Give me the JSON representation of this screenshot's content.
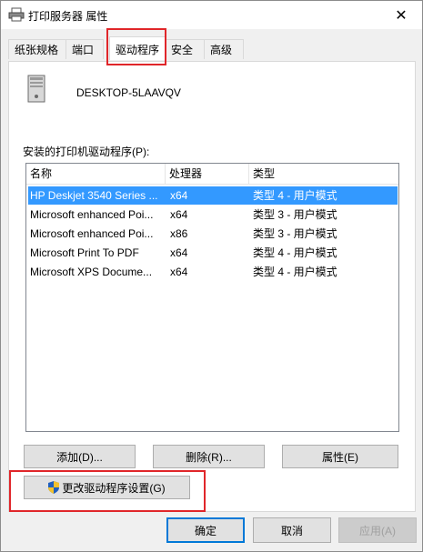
{
  "window": {
    "title": "打印服务器 属性",
    "close_glyph": "✕"
  },
  "tabs": [
    {
      "label": "纸张规格"
    },
    {
      "label": "端口"
    },
    {
      "label": "驱动程序"
    },
    {
      "label": "安全"
    },
    {
      "label": "高级"
    }
  ],
  "active_tab": "驱动程序",
  "server": {
    "computer_name": "DESKTOP-5LAAVQV"
  },
  "drivers": {
    "label": "安装的打印机驱动程序(P):",
    "columns": [
      {
        "label": "名称"
      },
      {
        "label": "处理器"
      },
      {
        "label": "类型"
      }
    ],
    "rows": [
      {
        "name": "HP Deskjet 3540 Series ...",
        "processor": "x64",
        "type": "类型 4 - 用户模式",
        "selected": true
      },
      {
        "name": "Microsoft enhanced Poi...",
        "processor": "x64",
        "type": "类型 3 - 用户模式",
        "selected": false
      },
      {
        "name": "Microsoft enhanced Poi...",
        "processor": "x86",
        "type": "类型 3 - 用户模式",
        "selected": false
      },
      {
        "name": "Microsoft Print To PDF",
        "processor": "x64",
        "type": "类型 4 - 用户模式",
        "selected": false
      },
      {
        "name": "Microsoft XPS Docume...",
        "processor": "x64",
        "type": "类型 4 - 用户模式",
        "selected": false
      }
    ]
  },
  "buttons": {
    "add": "添加(D)...",
    "remove": "删除(R)...",
    "properties": "属性(E)",
    "change_settings": "更改驱动程序设置(G)",
    "ok": "确定",
    "cancel": "取消",
    "apply": "应用(A)"
  },
  "colors": {
    "selection": "#3399ff",
    "annotation": "#e0262a",
    "default_button_border": "#0078d7"
  }
}
